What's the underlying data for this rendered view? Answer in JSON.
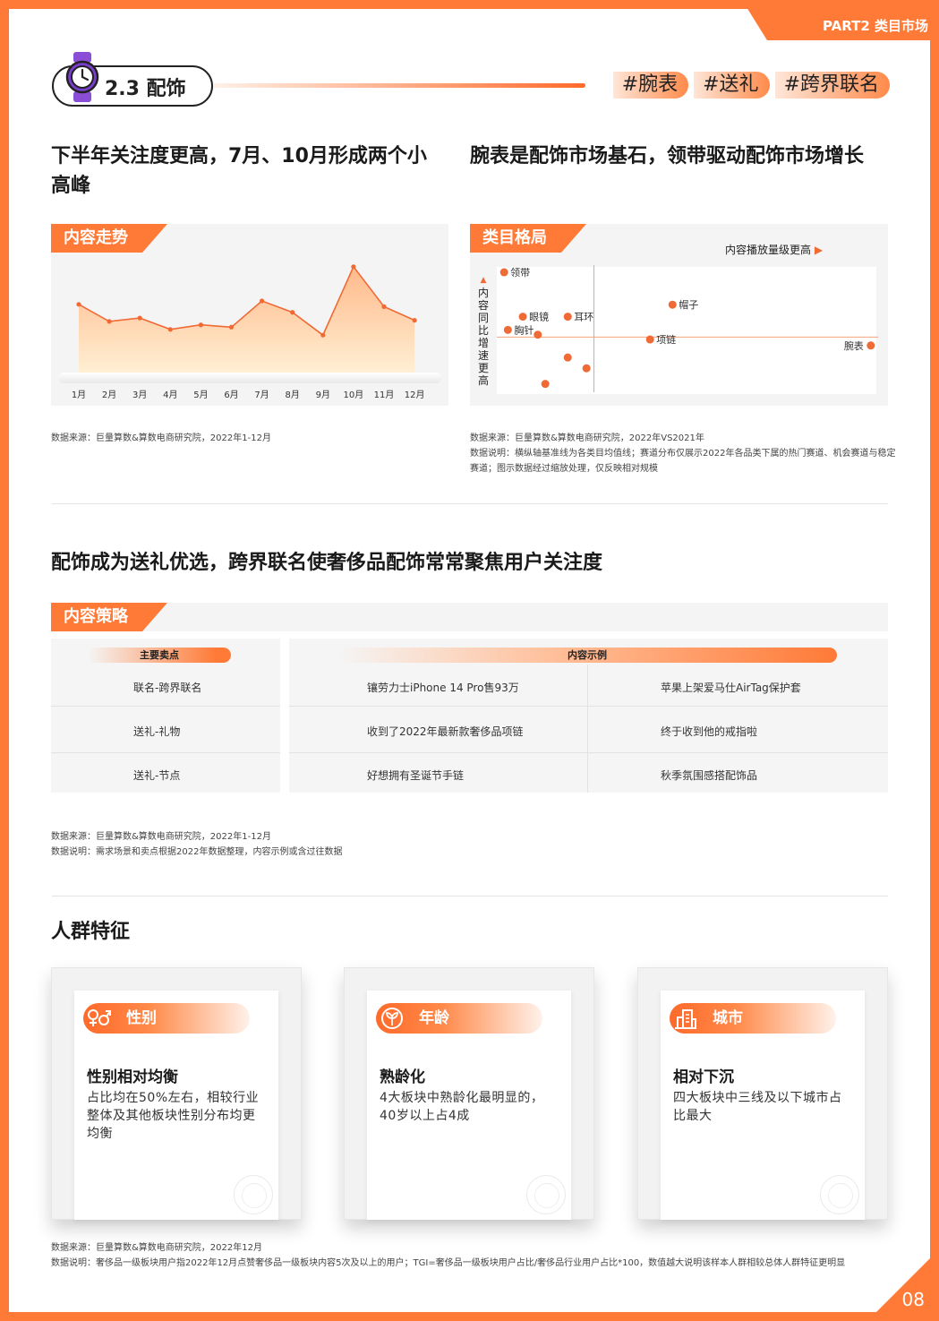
{
  "header": {
    "part_label": "PART2 类目市场",
    "section_title": "2.3 配饰",
    "tags": [
      "#腕表",
      "#送礼",
      "#跨界联名"
    ],
    "page_number": "08"
  },
  "trend": {
    "heading": "下半年关注度更高，7月、10月形成两个小高峰",
    "ribbon": "内容走势",
    "source": "数据来源：巨量算数&算数电商研究院，2022年1-12月"
  },
  "category": {
    "heading": "腕表是配饰市场基石，领带驱动配饰市场增长",
    "ribbon": "类目格局",
    "x_axis_label": "内容播放量级更高",
    "y_axis_label": "内容同比增速更高",
    "source": "数据来源：巨量算数&算数电商研究院，2022年VS2021年",
    "note": "数据说明：横纵轴基准线为各类目均值线；赛道分布仅展示2022年各品类下属的热门赛道、机会赛道与稳定赛道；图示数据经过缩放处理，仅反映相对规模"
  },
  "chart_data": [
    {
      "type": "area",
      "title": "内容走势",
      "categories": [
        "1月",
        "2月",
        "3月",
        "4月",
        "5月",
        "6月",
        "7月",
        "8月",
        "9月",
        "10月",
        "11月",
        "12月"
      ],
      "values": [
        63,
        48,
        51,
        41,
        45,
        43,
        66,
        56,
        36,
        96,
        61,
        49
      ],
      "ylim": [
        0,
        110
      ],
      "grid": false,
      "color": "#ef6a35"
    },
    {
      "type": "scatter",
      "title": "类目格局",
      "xlabel": "内容播放量级更高",
      "ylabel": "内容同比增速更高",
      "xlim": [
        0,
        100
      ],
      "ylim": [
        0,
        100
      ],
      "baseline_x": 25,
      "baseline_y": 43,
      "color": "#ef6a35",
      "points": [
        {
          "label": "领带",
          "x": 1,
          "y": 97
        },
        {
          "label": "眼镜",
          "x": 6,
          "y": 60
        },
        {
          "label": "耳环",
          "x": 18,
          "y": 60
        },
        {
          "label": "胸针",
          "x": 2,
          "y": 49
        },
        {
          "label": "帽子",
          "x": 46,
          "y": 70
        },
        {
          "label": "项链",
          "x": 40,
          "y": 41
        },
        {
          "label": "腕表",
          "x": 99,
          "y": 36
        },
        {
          "label": "",
          "x": 18,
          "y": 26
        },
        {
          "label": "",
          "x": 23,
          "y": 17
        },
        {
          "label": "",
          "x": 12,
          "y": 4
        },
        {
          "label": "",
          "x": 10,
          "y": 45
        }
      ]
    }
  ],
  "strategy": {
    "heading": "配饰成为送礼优选，跨界联名使奢侈品配饰常常聚焦用户关注度",
    "ribbon": "内容策略",
    "col1_header": "主要卖点",
    "col2_header": "内容示例",
    "rows": [
      {
        "point": "联名-跨界联名",
        "ex1": "镶劳力士iPhone 14 Pro售93万",
        "ex2": "苹果上架爱马仕AirTag保护套"
      },
      {
        "point": "送礼-礼物",
        "ex1": "收到了2022年最新款奢侈品项链",
        "ex2": "终于收到他的戒指啦"
      },
      {
        "point": "送礼-节点",
        "ex1": "好想拥有圣诞节手链",
        "ex2": "秋季氛围感搭配饰品"
      }
    ],
    "source": "数据来源：巨量算数&算数电商研究院，2022年1-12月",
    "note": "数据说明：需求场景和卖点根据2022年数据整理，内容示例或含过往数据"
  },
  "people": {
    "heading": "人群特征",
    "cards": [
      {
        "tag": "性别",
        "icon": "gender-icon",
        "title": "性别相对均衡",
        "text": "占比均在50%左右，相较行业整体及其他板块性别分布均更均衡"
      },
      {
        "tag": "年龄",
        "icon": "sprout-icon",
        "title": "熟龄化",
        "text": "4大板块中熟龄化最明显的，40岁以上占4成"
      },
      {
        "tag": "城市",
        "icon": "city-icon",
        "title": "相对下沉",
        "text": "四大板块中三线及以下城市占比最大"
      }
    ],
    "source": "数据来源：巨量算数&算数电商研究院，2022年12月",
    "note": "数据说明：奢侈品一级板块用户指2022年12月点赞奢侈品一级板块内容5次及以上的用户；TGI=奢侈品一级板块用户占比/奢侈品行业用户占比*100，数值越大说明该样本人群相较总体人群特征更明显"
  }
}
